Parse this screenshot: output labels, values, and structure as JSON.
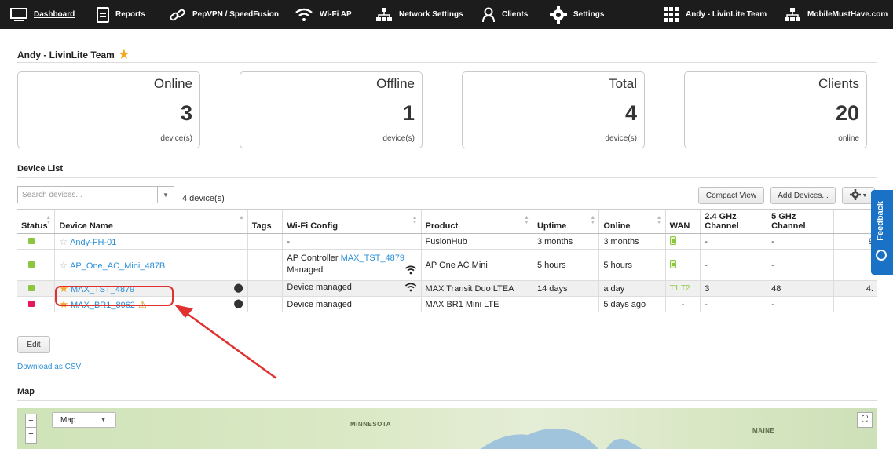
{
  "nav": {
    "dashboard": "Dashboard",
    "reports": "Reports",
    "pepvpn": "PepVPN / SpeedFusion",
    "wifi_ap": "Wi-Fi AP",
    "network_settings": "Network Settings",
    "clients": "Clients",
    "settings": "Settings",
    "group": "Andy - LivinLite Team",
    "org": "MobileMustHave.com"
  },
  "group_title": "Andy - LivinLite Team",
  "stats": [
    {
      "label": "Online",
      "value": "3",
      "unit": "device(s)"
    },
    {
      "label": "Offline",
      "value": "1",
      "unit": "device(s)"
    },
    {
      "label": "Total",
      "value": "4",
      "unit": "device(s)"
    },
    {
      "label": "Clients",
      "value": "20",
      "unit": "online"
    }
  ],
  "device_list": {
    "title": "Device List",
    "search_placeholder": "Search devices...",
    "count_text": "4 device(s)",
    "compact_view": "Compact View",
    "add_devices": "Add Devices...",
    "headers": {
      "status": "Status",
      "device_name": "Device Name",
      "tags": "Tags",
      "wifi_config": "Wi-Fi Config",
      "product": "Product",
      "uptime": "Uptime",
      "online": "Online",
      "wan": "WAN",
      "ghz24": "2.4 GHz Channel",
      "ghz5": "5 GHz Channel"
    },
    "rows": [
      {
        "status_color": "#8cc63f",
        "starred": false,
        "name": "Andy-FH-01",
        "wifi": "-",
        "product": "FusionHub",
        "uptime": "3 months",
        "online": "3 months",
        "ch24": "-",
        "ch5": "-",
        "extra": "9"
      },
      {
        "status_color": "#8cc63f",
        "starred": false,
        "name": "AP_One_AC_Mini_487B",
        "wifi_prefix": "AP Controller",
        "wifi_link": "MAX_TST_4879",
        "wifi_line2": "Managed",
        "product": "AP One AC Mini",
        "uptime": "5 hours",
        "online": "5 hours",
        "ch24": "-",
        "ch5": "-",
        "extra": ""
      },
      {
        "status_color": "#8cc63f",
        "starred": true,
        "name": "MAX_TST_4879",
        "wifi": "Device managed",
        "product": "MAX Transit Duo LTEA",
        "uptime": "14 days",
        "online": "a day",
        "wan_1": "1",
        "wan_2": "2",
        "ch24": "3",
        "ch5": "48",
        "extra": "4."
      },
      {
        "status_color": "#e8175d",
        "starred": true,
        "name": "MAX_BR1_8962",
        "wifi": "Device managed",
        "product": "MAX BR1 Mini LTE",
        "uptime": "",
        "online": "5 days ago",
        "wan": "-",
        "ch24": "-",
        "ch5": "-",
        "extra": ""
      }
    ]
  },
  "edit_button": "Edit",
  "download_csv": "Download as CSV",
  "map": {
    "title": "Map",
    "type_select": "Map",
    "zoom_in": "+",
    "zoom_out": "−",
    "labels": [
      "MINNESOTA",
      "MAINE"
    ]
  },
  "feedback": "Feedback"
}
